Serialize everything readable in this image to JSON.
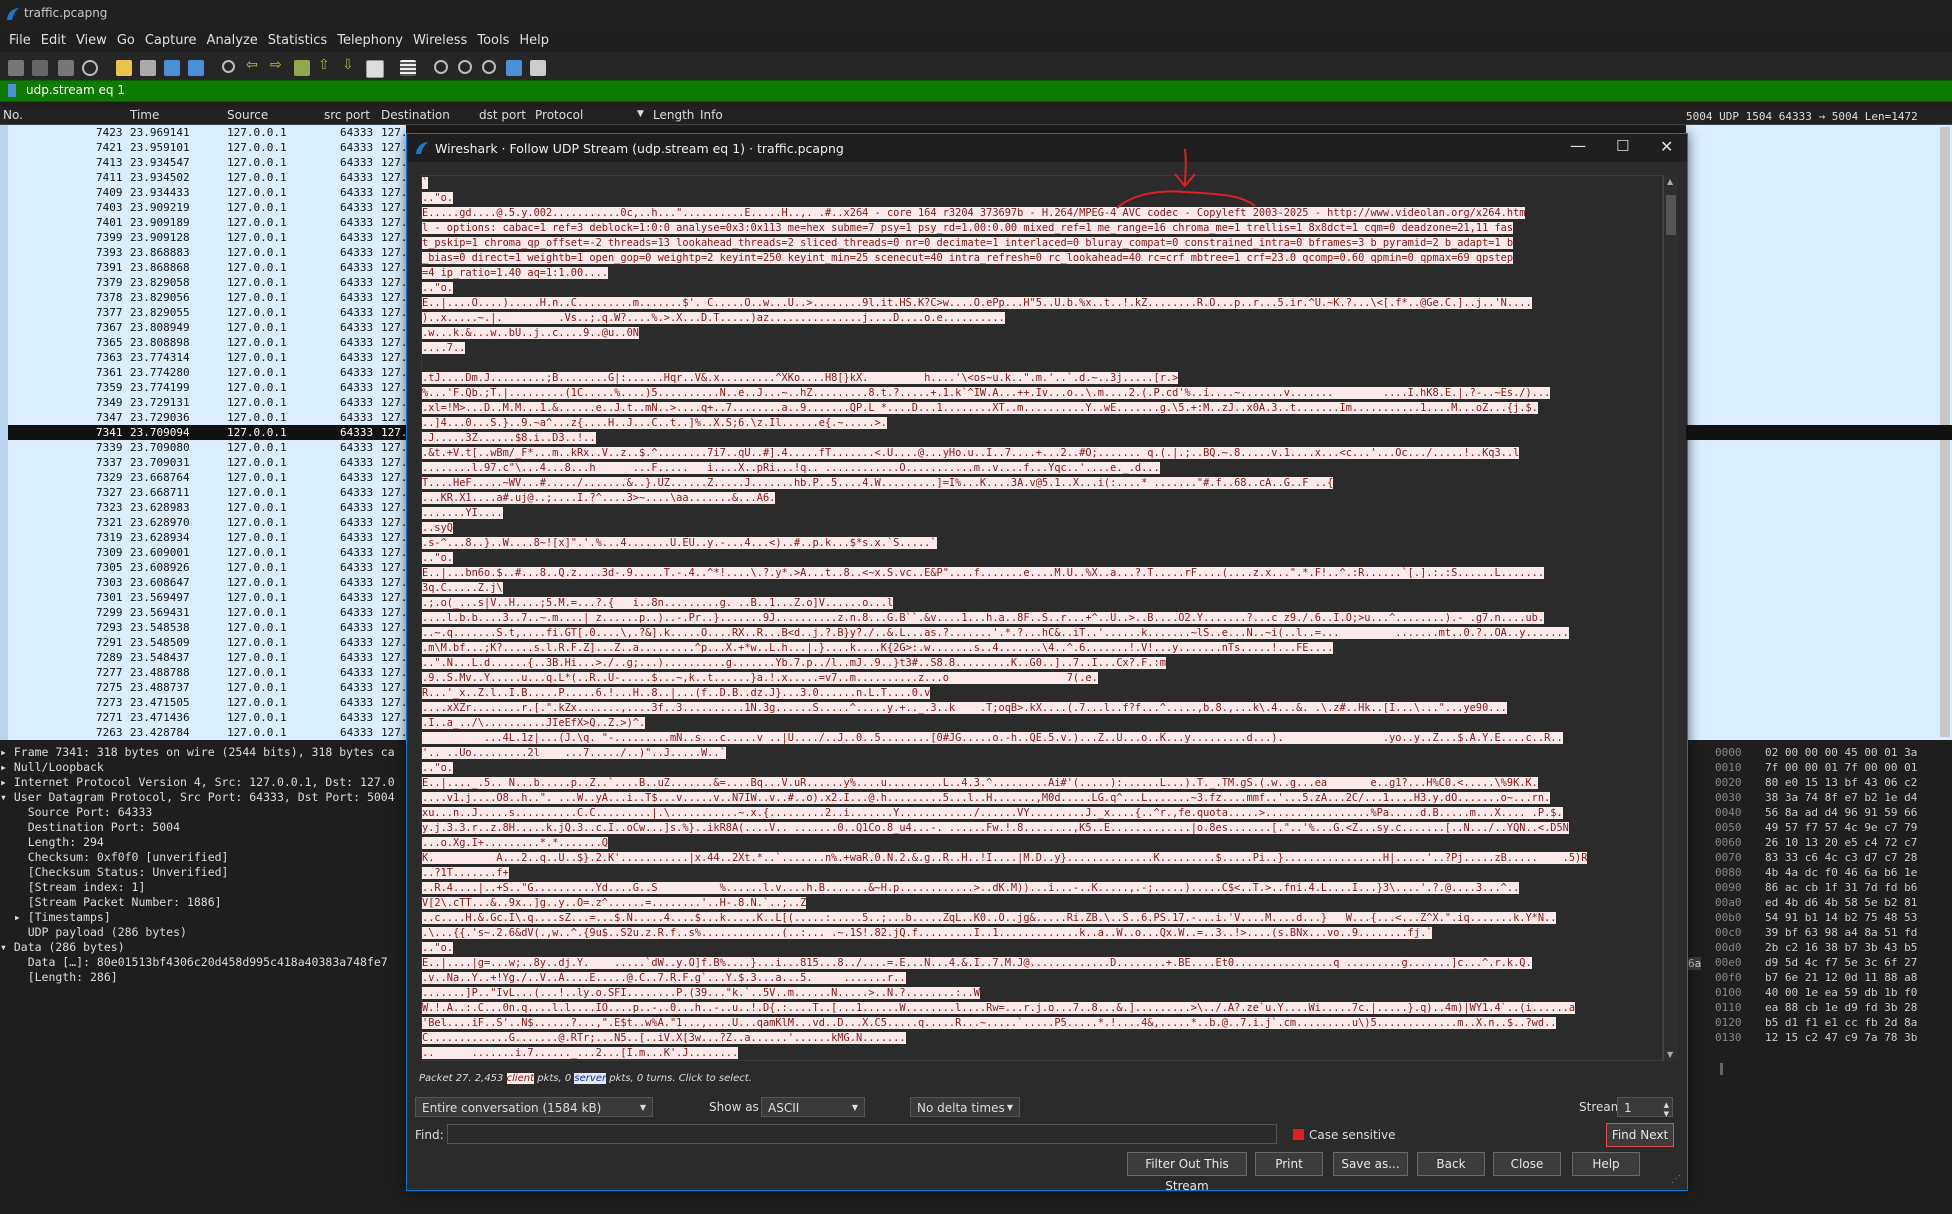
{
  "window": {
    "title": "traffic.pcapng",
    "menu": [
      "File",
      "Edit",
      "View",
      "Go",
      "Capture",
      "Analyze",
      "Statistics",
      "Telephony",
      "Wireless",
      "Tools",
      "Help"
    ]
  },
  "filter": {
    "value": "udp.stream eq 1"
  },
  "packet_list": {
    "columns": [
      "No.",
      "Time",
      "Source",
      "src port",
      "Destination",
      "dst port",
      "Protocol",
      "Length",
      "Info"
    ],
    "rows": [
      [
        "7423",
        "23.969141",
        "127.0.0.1",
        "64333",
        "127.0.0.1"
      ],
      [
        "7421",
        "23.959101",
        "127.0.0.1",
        "64333",
        "127."
      ],
      [
        "7413",
        "23.934547",
        "127.0.0.1",
        "64333",
        "127."
      ],
      [
        "7411",
        "23.934502",
        "127.0.0.1",
        "64333",
        "127."
      ],
      [
        "7409",
        "23.934433",
        "127.0.0.1",
        "64333",
        "127."
      ],
      [
        "7403",
        "23.909219",
        "127.0.0.1",
        "64333",
        "127."
      ],
      [
        "7401",
        "23.909189",
        "127.0.0.1",
        "64333",
        "127."
      ],
      [
        "7399",
        "23.909128",
        "127.0.0.1",
        "64333",
        "127."
      ],
      [
        "7393",
        "23.868883",
        "127.0.0.1",
        "64333",
        "127."
      ],
      [
        "7391",
        "23.868868",
        "127.0.0.1",
        "64333",
        "127."
      ],
      [
        "7379",
        "23.829058",
        "127.0.0.1",
        "64333",
        "127."
      ],
      [
        "7378",
        "23.829056",
        "127.0.0.1",
        "64333",
        "127."
      ],
      [
        "7377",
        "23.829055",
        "127.0.0.1",
        "64333",
        "127."
      ],
      [
        "7367",
        "23.808949",
        "127.0.0.1",
        "64333",
        "127."
      ],
      [
        "7365",
        "23.808898",
        "127.0.0.1",
        "64333",
        "127."
      ],
      [
        "7363",
        "23.774314",
        "127.0.0.1",
        "64333",
        "127."
      ],
      [
        "7361",
        "23.774280",
        "127.0.0.1",
        "64333",
        "127."
      ],
      [
        "7359",
        "23.774199",
        "127.0.0.1",
        "64333",
        "127."
      ],
      [
        "7349",
        "23.729131",
        "127.0.0.1",
        "64333",
        "127."
      ],
      [
        "7347",
        "23.729036",
        "127.0.0.1",
        "64333",
        "127."
      ],
      [
        "7341",
        "23.709094",
        "127.0.0.1",
        "64333",
        "127."
      ],
      [
        "7339",
        "23.709080",
        "127.0.0.1",
        "64333",
        "127."
      ],
      [
        "7337",
        "23.709031",
        "127.0.0.1",
        "64333",
        "127."
      ],
      [
        "7329",
        "23.668764",
        "127.0.0.1",
        "64333",
        "127."
      ],
      [
        "7327",
        "23.668711",
        "127.0.0.1",
        "64333",
        "127."
      ],
      [
        "7323",
        "23.628983",
        "127.0.0.1",
        "64333",
        "127."
      ],
      [
        "7321",
        "23.628970",
        "127.0.0.1",
        "64333",
        "127."
      ],
      [
        "7319",
        "23.628934",
        "127.0.0.1",
        "64333",
        "127."
      ],
      [
        "7309",
        "23.609001",
        "127.0.0.1",
        "64333",
        "127."
      ],
      [
        "7305",
        "23.608926",
        "127.0.0.1",
        "64333",
        "127."
      ],
      [
        "7303",
        "23.608647",
        "127.0.0.1",
        "64333",
        "127."
      ],
      [
        "7301",
        "23.569497",
        "127.0.0.1",
        "64333",
        "127."
      ],
      [
        "7299",
        "23.569431",
        "127.0.0.1",
        "64333",
        "127."
      ],
      [
        "7293",
        "23.548538",
        "127.0.0.1",
        "64333",
        "127."
      ],
      [
        "7291",
        "23.548509",
        "127.0.0.1",
        "64333",
        "127."
      ],
      [
        "7289",
        "23.548437",
        "127.0.0.1",
        "64333",
        "127."
      ],
      [
        "7277",
        "23.488788",
        "127.0.0.1",
        "64333",
        "127."
      ],
      [
        "7275",
        "23.488737",
        "127.0.0.1",
        "64333",
        "127."
      ],
      [
        "7273",
        "23.471505",
        "127.0.0.1",
        "64333",
        "127."
      ],
      [
        "7271",
        "23.471436",
        "127.0.0.1",
        "64333",
        "127."
      ],
      [
        "7263",
        "23.428784",
        "127.0.0.1",
        "64333",
        "127."
      ]
    ],
    "selected_index": 20,
    "top_row_extra": "5004  UDP  1504 64333 → 5004 Len=1472"
  },
  "details": [
    "▸ Frame 7341: 318 bytes on wire (2544 bits), 318 bytes ca",
    "▸ Null/Loopback",
    "▸ Internet Protocol Version 4, Src: 127.0.0.1, Dst: 127.0",
    "▾ User Datagram Protocol, Src Port: 64333, Dst Port: 5004",
    "    Source Port: 64333",
    "    Destination Port: 5004",
    "    Length: 294",
    "    Checksum: 0xf0f0 [unverified]",
    "    [Checksum Status: Unverified]",
    "    [Stream index: 1]",
    "    [Stream Packet Number: 1886]",
    "  ▸ [Timestamps]",
    "    UDP payload (286 bytes)",
    "▾ Data (286 bytes)",
    "    Data […]: 80e01513bf4306c20d458d995c418a40383a748fe7",
    "    [Length: 286]"
  ],
  "hex": [
    [
      "0000",
      "02 00 00 00 45 00 01 3a"
    ],
    [
      "0010",
      "7f 00 00 01 7f 00 00 01"
    ],
    [
      "0020",
      "80 e0 15 13 bf 43 06 c2"
    ],
    [
      "0030",
      "38 3a 74 8f e7 b2 1e d4"
    ],
    [
      "0040",
      "56 8a ad d4 96 91 59 66"
    ],
    [
      "0050",
      "49 57 f7 57 4c 9e c7 79"
    ],
    [
      "0060",
      "26 10 13 20 e5 c4 72 c7"
    ],
    [
      "0070",
      "83 33 c6 4c c3 d7 c7 28"
    ],
    [
      "0080",
      "4b 4a dc f0 46 6a b6 1e"
    ],
    [
      "0090",
      "86 ac cb 1f 31 7d fd b6"
    ],
    [
      "00a0",
      "ed 4b d6 4b 58 5e b2 81"
    ],
    [
      "00b0",
      "54 91 b1 14 b2 75 48 53"
    ],
    [
      "00c0",
      "39 bf 63 98 a4 8a 51 fd"
    ],
    [
      "00d0",
      "2b c2 16 38 b7 3b 43 b5"
    ],
    [
      "00e0",
      "d9 5d 4c f7 5e 3c 6f 27"
    ],
    [
      "00f0",
      "b7 6e 21 12 0d 11 88 a8"
    ],
    [
      "0100",
      "40 00 1e ea 59 db 1b f0"
    ],
    [
      "0110",
      "ea 88 cb 1e d9 fd 3b 28"
    ],
    [
      "0120",
      "b5 d1 f1 e1 cc fb 2d 8a"
    ],
    [
      "0130",
      "12 15 c2 47 c9 7a 78 3b"
    ]
  ],
  "hex_extra": "6a",
  "dialog": {
    "title": "Wireshark · Follow UDP Stream (udp.stream eq 1) · traffic.pcapng",
    "stream_lines": [
      {
        "t": "`"
      },
      {
        "t": "..\"o."
      },
      {
        "t": "E.....gd....@.5.y.002...........0c,..h...\"..........E.....H..,. .#..x264 - core 164 r3204 373697b - H.264/MPEG-4 AVC codec - Copyleft 2003-2025 - http://www.videolan.org/x264.htm",
        "h": true
      },
      {
        "t": "l - options: cabac=1 ref=3 deblock=1:0:0 analyse=0x3:0x113 me=hex subme=7 psy=1 psy_rd=1.00:0.00 mixed_ref=1 me_range=16 chroma_me=1 trellis=1 8x8dct=1 cqm=0 deadzone=21,11 fas",
        "h": true
      },
      {
        "t": "t_pskip=1 chroma_qp_offset=-2 threads=13 lookahead_threads=2 sliced_threads=0 nr=0 decimate=1 interlaced=0 bluray_compat=0 constrained_intra=0 bframes=3 b_pyramid=2 b_adapt=1 b",
        "h": true
      },
      {
        "t": "_bias=0 direct=1 weightb=1 open_gop=0 weightp=2 keyint=250 keyint_min=25 scenecut=40 intra_refresh=0 rc_lookahead=40 rc=crf mbtree=1 crf=23.0 qcomp=0.60 qpmin=0 qpmax=69 qpstep",
        "h": true
      },
      {
        "t": "=4 ip_ratio=1.40 aq=1:1.00....",
        "h": true
      },
      {
        "t": "..\"o."
      },
      {
        "t": "E..|....O....).....H.n..C.........m.......$'. C.....O..w...U..>........9l.it.HS.K?C>w....O.ePp...H\"5..U.b.%x..t..!.kZ........R.O...p..r...5.ir.^U.~K.?...\\<[.f*..@Ge.C.]..j..'N....",
        "h": true
      },
      {
        "t": ")..x.....~.|.         .Vs..;.q.W?....%.>.X...D.T.....)az...............j....D....o.e..........",
        "h": true
      },
      {
        "t": ".w...k.&...w..bU..j..c....9..@u..0N",
        "h": true
      },
      {
        "t": "....7..",
        "h": true
      },
      {
        "t": ""
      },
      {
        "t": ".tJ....Dm.J.........;B........G|:......Hqr..V&.x.........^XKo....H8[}kX.         h....'\\<os~u.k..\".m.'..`.d.~..3j.....[r.>",
        "h": true
      },
      {
        "t": "%...'F.Qb.;T.|.........(1C.....%....)5..........N..e..J...~..hZ.........8.t.?.....+.1.k`^IW.A...++.Iv...o..\\.m....2.(.P.cd'%..i....~.......v.......        ....I.hK8.E.|.?-..~Es./)...",
        "h": true
      },
      {
        "t": ".xl=!M>...D..M.M...1.&......e..J.t..mN..>....q+..7........a..9.......QP.L *....D...1........XT..m..........Y..wE.......g.\\5.+:M..zJ..x0A.3..t.......Im...........1....M...oZ...{j.$.",
        "h": true
      },
      {
        "t": "..]4...0...S.}..9.~a^...z{....H..J...C..t..]%..X.S;6.\\z.Il......e{.~.....>.",
        "h": true
      },
      {
        "t": ".J.....3Z......$8.i..D3..!..",
        "h": true
      },
      {
        "t": ".&t.+V.t[..wBm/_F*...m..kRx..V..z..$.^........7i7..qU..#].4.....fT.......<.U....@...yHo.u..I..7....+...2..#O;....... q.(.|.;..BQ.~.8.....v.1....x...<c...'...Oc.../.....!..Kq3..l",
        "h": true
      },
      {
        "t": "........l.97.c\"\\...4...8...h      ...F.....   i....X..pRi...!q.. ............O...........m..v....f...Yqc..'....e._.d...",
        "h": true
      },
      {
        "t": "T....HeF.....~WV...#...../.......&..}.UZ......Z.....J.......hb.P..5....4.W.........]=I%...K....3A.v@5.1..X...i(:....* .......\"#.f..68..cA..G..F ..{",
        "h": true
      },
      {
        "t": "...KR.X1....a#.uj@..;....I.?^....3>~....\\aa.......&...A6.",
        "h": true
      },
      {
        "t": ".......YI....",
        "h": true
      },
      {
        "t": "..syQ",
        "h": true
      },
      {
        "t": ".s-^...8..}..W....8~![x]\".'.%...4.......U.EU..y.-...4...<)..#..p.k...$*s.x.`S.....`",
        "h": true
      },
      {
        "t": "..\"o."
      },
      {
        "t": "E..|...bn6o.$..#...8..Q.z....3d-.9.....T.-.4..^*!....\\.?.y*.>A...t..8..<~x.S.vc..E&P\"....f.......e....M.U..%X..a...?.T.....rF....(....z.x...\".*.F!..^.:R......`[.].:.:S......L.......",
        "h": true
      },
      {
        "t": "3q.C.....Z.j\\",
        "h": true
      },
      {
        "t": ".;.o(_...s|V..H....;5.M.=...?.{   i..8n.........g. ..B..1...Z.o]V......o...l",
        "h": true
      },
      {
        "t": "....l.b.b....3..7..~.m....| z......p..)..-.Pr..}.......9J..........z.n.8...G.B``.&v....1...h.a..8F..S..r...+^..U..>..B....O2.Y.......?...c z9./.6..I.O;>u...^........).- .g7.n....ub.",
        "h": true
      },
      {
        "t": "..~.q.......S.t,....fi.GT[.0....\\,.?&].k.....O....RX..R...B<d..j.?.B}y?./..&.L...as.?.......'.*.?...hC&..iT..'......k.......~lS..e...N..~i(..l..=...         .......mt..0.?..OA..y.......",
        "h": true
      },
      {
        "t": ".m\\M.bf...;K?.....s.l.R.F.Z]...Z..a.........^p...X.+*w..L.h...|.}....k....K{2G>:.w.......s..4.......\\4..^.6.......!.V!...y.......nTs.....!...FE....",
        "h": true
      },
      {
        "t": "..\".N...L.d......{..3B.Hi...>./..g;...)..........g.......Yb.7.p../l..mJ..9..}t3#..S8.8.........K..G0..]..7..I...Cx?.F.:m",
        "h": true
      },
      {
        "t": ".9..S.Mv..Y.....u...q.L*(..R..U-.....$...~,k..t......}a.!.x.....=v7..m..........z...o                   7(.e.",
        "h": true
      },
      {
        "t": "R...'_x..Z.l..I.B.....P.....6.!...H..8..|...(f..D.B..dz.J}...3.0......n.L.T....0.v",
        "h": true
      },
      {
        "t": "....xXZr........r.[.\".kZx.......,....3f..3..........1N.3g......S.....^.....y.+.._.3..k    .T;oqB>.kX....(.7...l..f?f...^.....,b.8.,...k\\.4...&. .\\.z#..Hk..[I...\\...\"...ye90...",
        "h": true
      },
      {
        "t": ".I..a_../\\..........JIeEfX>Q..Z.>)^.",
        "h": true
      },
      {
        "t": "          ...4L.1z|...(J.\\q. \"-.........mN..s...c.....v ..|U..../..J..0..5........[0#JG.....o.-h..QE.5.v.)...Z..U...o..K...y.........d...).                .yo..y..Z...$.A.Y.E....c..R..",
        "h": true
      },
      {
        "t": "'.. ..Uo.........2l    ...7...../..)\"..J.....W..`",
        "h": true
      },
      {
        "t": "..\"o."
      },
      {
        "t": "E..|...._.5.. N...b.....p..Z..`....B..uZ.......&=....Bq...V.uR......y%....u.........L..4.3.^.........Ai#'(.....):......L...).T._.TM.gS.(.w..g...ea       e..g1?...H%C0.<.....\\%9K.K.",
        "h": true
      },
      {
        "t": "....v1.j....O8..h..\". ...W..yA...i..T$...v.....v..N7IW..v..#..o).x2.I...@.h.........5...l..H.......,M0d.....LG.q^...L.......~3.fz....mmf..'...5.zA...2C/...1....H3.y.dO.......o~...rn.",
        "h": true
      },
      {
        "t": "xu...n..J.....s..........C.C.........|.\\...........~.x.{.........2..i.......Y............/......VY.........J._x....{..^r.,fe.quota.....>.................%Pa.....d.B.....m...X.... .P.$.",
        "h": true
      },
      {
        "t": "y.j.3.3.r..z.8H.....k.jQ.3..c.I..oCw...]s.%}..ikR8A(....V.. .......0..Q1Co.8_u4...-. ......Fw.!.8........,K5..E.............|o.8es.......[.\"..'%...G.<Z...sy.c.......[..N.../..YQN..<.D5N",
        "h": true
      },
      {
        "t": "...o.Xg.I+.........*.*.......Q",
        "h": true
      },
      {
        "t": "K.          A...2..q..U..$}.2.K'...........|x.44..2Xt.*..`.......n%.+waR.0.N.2.&.g..R..H..!I....|M.D..y}..............K.........$.....Pi..}................H|.....'..?Pj.....zB.....    .5)R",
        "h": true
      },
      {
        "t": "..?1T.......f+",
        "h": true
      },
      {
        "t": "..R.4....|..+S..\"G..........Yd....G..S          %......l.v....h.B.......&~H.p............>..dK.M))...i...-..K.....,.-;.....).....C$<..T.>..fni.4.L....I...}3\\....'.?.@....3...^..",
        "h": true
      },
      {
        "t": "V[2\\.cTT...&..9x..]g..y..O=.z^......=........'..H-.8.N.`..;..Z",
        "h": true
      },
      {
        "t": "..c....H.&.Gc.I\\.q....sZ...=...$.N.....4....$...k.....K..L[(.....:.....5..;...b.....ZqL..K0..O..jg&.....Ri.ZB.\\..S..6.PS.17.-...i.'V....M....d...}   W...{...<...Z^X.\".iq.......k.Y*N..",
        "h": true
      },
      {
        "t": ".\\...{{.'s~.2.6&dV(.,w..^.{9u$..S2u.z.R.f..s%.............(..:... .~.1S!.82.jQ.f.........I..1.............k..a..W..o...Qx.W..=..3..!>....(s.BNx...vo..9........fj.`",
        "h": true
      },
      {
        "t": "..\"o."
      },
      {
        "t": "E..|....|g=...w;..8y..dj.Y.    .....`dW..y.O]f.B%....}...i...815...8../....=.E...N...4.&.I..7.M.J@.............D........+.BE....Et0................q .........g.......]c...^.r.k.Q.",
        "h": true
      },
      {
        "t": ".v..Na..Y..+!Yg./..V..A....E.....@.C..7.R.F.g`...Y.$.3...a...5.     .......r..",
        "h": true
      },
      {
        "t": ".......]P..\"IvL...(...!..ly.o.SFI........P.(39...\"k.`..5V..m......N.....>..N.?........:..W",
        "h": true
      },
      {
        "t": "W.!.A..:.C...0n.q....l.l....IO....p..-..0...h..-..u..!.D{.:....T..[...1......W........l....Rw=...r.j.o...7..8...&.].........>\\../.A?.ze`u.Y....Wi.....7c.|.....}.q)..4m)|WY1.4`..(i......a",
        "h": true
      },
      {
        "t": "'Bel....iF..S'..N$......?...,\".E$t..w%A.\"1...,....U...qamKlM...vd..D...X.C5.....q.....R...~.....`.....P5.....*.!....4&,.....*..b.@..7.i.j`.cm.........u\\)5.............m..X.n..$..?wd..",
        "h": true
      },
      {
        "t": "C.............G.......@.RTr;...N5..[..iV.X[3w...?Z..a......'......kMG.N.......",
        "h": true
      },
      {
        "t": "..      .......i.7......_...2...[I.m...K'.J........",
        "h": true
      }
    ],
    "packet_info": {
      "prefix": "Packet 27. 2,453 ",
      "client": "client",
      "mid": " pkts, 0 ",
      "server": "server",
      "suffix": " pkts, 0 turns. Click to select."
    },
    "conversation": "Entire conversation (1584 kB)",
    "show_as_label": "Show as",
    "show_as": "ASCII",
    "delta": "No delta times",
    "stream_label": "Stream",
    "stream_value": "1",
    "find_label": "Find:",
    "find_value": "",
    "case_sensitive": "Case sensitive",
    "buttons": {
      "find_next": "Find Next",
      "filter_out": "Filter Out This Stream",
      "print": "Print",
      "save_as": "Save as...",
      "back": "Back",
      "close": "Close",
      "help": "Help"
    }
  },
  "colors": {
    "filter_bg": "#0d7a00",
    "client_bg": "#fbeaea",
    "client_fg": "#8a1515",
    "list_bg": "#daeeff",
    "annotation": "#e02020"
  }
}
